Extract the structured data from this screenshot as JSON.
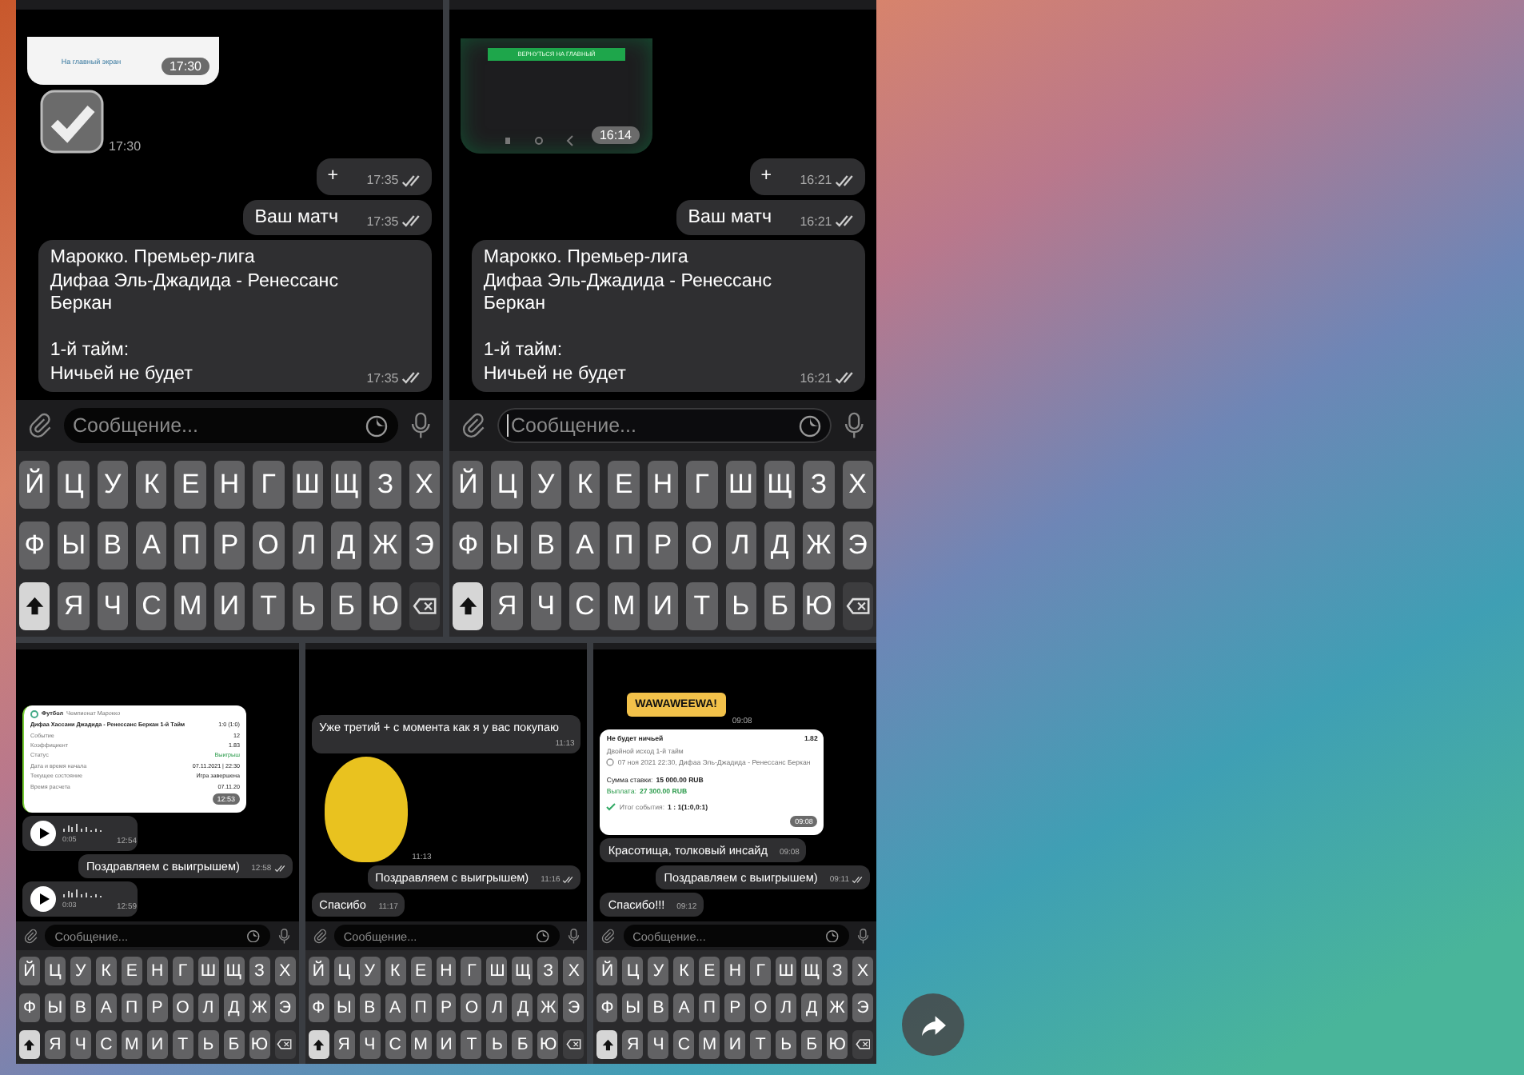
{
  "collage": {
    "top_row": [
      {
        "messages": [
          {
            "kind": "link_screenshot",
            "caption": "На главный экран",
            "time": "17:30"
          },
          {
            "kind": "check_sticker",
            "time": "17:30"
          },
          {
            "kind": "text",
            "outgoing": true,
            "text": "+",
            "time": "17:35",
            "read": true
          },
          {
            "kind": "text",
            "outgoing": true,
            "text": "Ваш  матч",
            "time": "17:35",
            "read": true
          },
          {
            "kind": "text",
            "outgoing": true,
            "text": "Марокко. Премьер-лига\nДифаа Эль-Джадида - Ренессанс\nБеркан\n\n1-й тайм:\nНичьей не будет",
            "time": "17:35",
            "read": true
          }
        ],
        "composer": {
          "placeholder": "Сообщение...",
          "focused": false
        },
        "keyboard": {
          "rows": [
            [
              {
                "kind": "letter",
                "label": "Й"
              },
              {
                "kind": "letter",
                "label": "Ц"
              },
              {
                "kind": "letter",
                "label": "У"
              },
              {
                "kind": "letter",
                "label": "К"
              },
              {
                "kind": "letter",
                "label": "Е"
              },
              {
                "kind": "letter",
                "label": "Н"
              },
              {
                "kind": "letter",
                "label": "Г"
              },
              {
                "kind": "letter",
                "label": "Ш"
              },
              {
                "kind": "letter",
                "label": "Щ"
              },
              {
                "kind": "letter",
                "label": "З"
              },
              {
                "kind": "letter",
                "label": "Х"
              }
            ],
            [
              {
                "kind": "letter",
                "label": "Ф"
              },
              {
                "kind": "letter",
                "label": "Ы"
              },
              {
                "kind": "letter",
                "label": "В"
              },
              {
                "kind": "letter",
                "label": "А"
              },
              {
                "kind": "letter",
                "label": "П"
              },
              {
                "kind": "letter",
                "label": "Р"
              },
              {
                "kind": "letter",
                "label": "О"
              },
              {
                "kind": "letter",
                "label": "Л"
              },
              {
                "kind": "letter",
                "label": "Д"
              },
              {
                "kind": "letter",
                "label": "Ж"
              },
              {
                "kind": "letter",
                "label": "Э"
              }
            ],
            [
              {
                "kind": "shift",
                "on": true
              },
              {
                "kind": "letter",
                "label": "Я"
              },
              {
                "kind": "letter",
                "label": "Ч"
              },
              {
                "kind": "letter",
                "label": "С"
              },
              {
                "kind": "letter",
                "label": "М"
              },
              {
                "kind": "letter",
                "label": "И"
              },
              {
                "kind": "letter",
                "label": "Т"
              },
              {
                "kind": "letter",
                "label": "Ь"
              },
              {
                "kind": "letter",
                "label": "Б"
              },
              {
                "kind": "letter",
                "label": "Ю"
              },
              {
                "kind": "backspace"
              }
            ]
          ]
        }
      },
      {
        "messages": [
          {
            "kind": "button_screenshot",
            "caption": "ВЕРНУТЬСЯ НА ГЛАВНЫЙ",
            "time": "16:14"
          },
          {
            "kind": "text",
            "outgoing": true,
            "text": "+",
            "time": "16:21",
            "read": true
          },
          {
            "kind": "text",
            "outgoing": true,
            "text": "Ваш матч",
            "time": "16:21",
            "read": true
          },
          {
            "kind": "text",
            "outgoing": true,
            "text": "Марокко. Премьер-лига\nДифаа Эль-Джадида - Ренессанс\nБеркан\n\n1-й тайм:\nНичьей не будет",
            "time": "16:21",
            "read": true
          }
        ],
        "composer": {
          "placeholder": "Сообщение...",
          "focused": true
        },
        "keyboard": {
          "rows": [
            [
              {
                "kind": "letter",
                "label": "Й"
              },
              {
                "kind": "letter",
                "label": "Ц"
              },
              {
                "kind": "letter",
                "label": "У"
              },
              {
                "kind": "letter",
                "label": "К"
              },
              {
                "kind": "letter",
                "label": "Е"
              },
              {
                "kind": "letter",
                "label": "Н"
              },
              {
                "kind": "letter",
                "label": "Г"
              },
              {
                "kind": "letter",
                "label": "Ш"
              },
              {
                "kind": "letter",
                "label": "Щ"
              },
              {
                "kind": "letter",
                "label": "З"
              },
              {
                "kind": "letter",
                "label": "Х"
              }
            ],
            [
              {
                "kind": "letter",
                "label": "Ф"
              },
              {
                "kind": "letter",
                "label": "Ы"
              },
              {
                "kind": "letter",
                "label": "В"
              },
              {
                "kind": "letter",
                "label": "А"
              },
              {
                "kind": "letter",
                "label": "П"
              },
              {
                "kind": "letter",
                "label": "Р"
              },
              {
                "kind": "letter",
                "label": "О"
              },
              {
                "kind": "letter",
                "label": "Л"
              },
              {
                "kind": "letter",
                "label": "Д"
              },
              {
                "kind": "letter",
                "label": "Ж"
              },
              {
                "kind": "letter",
                "label": "Э"
              }
            ],
            [
              {
                "kind": "shift",
                "on": true
              },
              {
                "kind": "letter",
                "label": "Я"
              },
              {
                "kind": "letter",
                "label": "Ч"
              },
              {
                "kind": "letter",
                "label": "С"
              },
              {
                "kind": "letter",
                "label": "М"
              },
              {
                "kind": "letter",
                "label": "И"
              },
              {
                "kind": "letter",
                "label": "Т"
              },
              {
                "kind": "letter",
                "label": "Ь"
              },
              {
                "kind": "letter",
                "label": "Б"
              },
              {
                "kind": "letter",
                "label": "Ю"
              },
              {
                "kind": "backspace"
              }
            ]
          ]
        }
      }
    ],
    "bottom_row": [
      {
        "messages": [
          {
            "kind": "result_card",
            "sport": "Футбол",
            "league": "Чемпионат Марокко",
            "match": "Дифаа Хассани Джадида - Ренессанс Беркан 1-й Тайм",
            "score": "1:0 (1:0)",
            "rows": [
              {
                "label": "Событие",
                "value": "12"
              },
              {
                "label": "Коэффициент",
                "value": "1.83"
              },
              {
                "label": "Статус",
                "value": "Выигрыш"
              },
              {
                "label": "Дата и время начала",
                "value": "07.11.2021 | 22:30"
              },
              {
                "label": "Текущее состояние",
                "value": "Игра завершена"
              },
              {
                "label": "Время расчета",
                "value": "07.11.20"
              }
            ],
            "time": "12:53"
          },
          {
            "kind": "voice",
            "duration": "0:05",
            "time": "12:54"
          },
          {
            "kind": "text",
            "outgoing": true,
            "text": "Поздравляем с выигрышем)",
            "time": "12:58",
            "read": true
          },
          {
            "kind": "voice",
            "duration": "0:03",
            "time": "12:59"
          }
        ],
        "composer": {
          "placeholder": "Сообщение...",
          "focused": false
        },
        "keyboard": {
          "rows": [
            [
              {
                "kind": "letter",
                "label": "Й"
              },
              {
                "kind": "letter",
                "label": "Ц"
              },
              {
                "kind": "letter",
                "label": "У"
              },
              {
                "kind": "letter",
                "label": "К"
              },
              {
                "kind": "letter",
                "label": "Е"
              },
              {
                "kind": "letter",
                "label": "Н"
              },
              {
                "kind": "letter",
                "label": "Г"
              },
              {
                "kind": "letter",
                "label": "Ш"
              },
              {
                "kind": "letter",
                "label": "Щ"
              },
              {
                "kind": "letter",
                "label": "З"
              },
              {
                "kind": "letter",
                "label": "Х"
              }
            ],
            [
              {
                "kind": "letter",
                "label": "Ф"
              },
              {
                "kind": "letter",
                "label": "Ы"
              },
              {
                "kind": "letter",
                "label": "В"
              },
              {
                "kind": "letter",
                "label": "А"
              },
              {
                "kind": "letter",
                "label": "П"
              },
              {
                "kind": "letter",
                "label": "Р"
              },
              {
                "kind": "letter",
                "label": "О"
              },
              {
                "kind": "letter",
                "label": "Л"
              },
              {
                "kind": "letter",
                "label": "Д"
              },
              {
                "kind": "letter",
                "label": "Ж"
              },
              {
                "kind": "letter",
                "label": "Э"
              }
            ],
            [
              {
                "kind": "shift",
                "on": true
              },
              {
                "kind": "letter",
                "label": "Я"
              },
              {
                "kind": "letter",
                "label": "Ч"
              },
              {
                "kind": "letter",
                "label": "С"
              },
              {
                "kind": "letter",
                "label": "М"
              },
              {
                "kind": "letter",
                "label": "И"
              },
              {
                "kind": "letter",
                "label": "Т"
              },
              {
                "kind": "letter",
                "label": "Ь"
              },
              {
                "kind": "letter",
                "label": "Б"
              },
              {
                "kind": "letter",
                "label": "Ю"
              },
              {
                "kind": "backspace"
              }
            ]
          ]
        }
      },
      {
        "messages": [
          {
            "kind": "text",
            "outgoing": false,
            "text": "Уже третий + с момента как я у вас покупаю",
            "time": "11:13"
          },
          {
            "kind": "photo_sticker",
            "time": "11:13"
          },
          {
            "kind": "text",
            "outgoing": true,
            "text": "Поздравляем с выигрышем)",
            "time": "11:16",
            "read": true
          },
          {
            "kind": "text",
            "outgoing": false,
            "text": "Спасибо",
            "time": "11:17"
          }
        ],
        "composer": {
          "placeholder": "Сообщение...",
          "focused": false
        },
        "keyboard": {
          "rows": [
            [
              {
                "kind": "letter",
                "label": "Й"
              },
              {
                "kind": "letter",
                "label": "Ц"
              },
              {
                "kind": "letter",
                "label": "У"
              },
              {
                "kind": "letter",
                "label": "К"
              },
              {
                "kind": "letter",
                "label": "Е"
              },
              {
                "kind": "letter",
                "label": "Н"
              },
              {
                "kind": "letter",
                "label": "Г"
              },
              {
                "kind": "letter",
                "label": "Ш"
              },
              {
                "kind": "letter",
                "label": "Щ"
              },
              {
                "kind": "letter",
                "label": "З"
              },
              {
                "kind": "letter",
                "label": "Х"
              }
            ],
            [
              {
                "kind": "letter",
                "label": "Ф"
              },
              {
                "kind": "letter",
                "label": "Ы"
              },
              {
                "kind": "letter",
                "label": "В"
              },
              {
                "kind": "letter",
                "label": "А"
              },
              {
                "kind": "letter",
                "label": "П"
              },
              {
                "kind": "letter",
                "label": "Р"
              },
              {
                "kind": "letter",
                "label": "О"
              },
              {
                "kind": "letter",
                "label": "Л"
              },
              {
                "kind": "letter",
                "label": "Д"
              },
              {
                "kind": "letter",
                "label": "Ж"
              },
              {
                "kind": "letter",
                "label": "Э"
              }
            ],
            [
              {
                "kind": "shift",
                "on": true
              },
              {
                "kind": "letter",
                "label": "Я"
              },
              {
                "kind": "letter",
                "label": "Ч"
              },
              {
                "kind": "letter",
                "label": "С"
              },
              {
                "kind": "letter",
                "label": "М"
              },
              {
                "kind": "letter",
                "label": "И"
              },
              {
                "kind": "letter",
                "label": "Т"
              },
              {
                "kind": "letter",
                "label": "Ь"
              },
              {
                "kind": "letter",
                "label": "Б"
              },
              {
                "kind": "letter",
                "label": "Ю"
              },
              {
                "kind": "backspace"
              }
            ]
          ]
        }
      },
      {
        "messages": [
          {
            "kind": "text_sticker",
            "text": "WAWAWEEWA!",
            "time": "09:08"
          },
          {
            "kind": "bet_card",
            "title": "Не будет ничьей",
            "odds": "1.82",
            "market": "Двойной исход 1-й тайм",
            "event": "07 ноя 2021 22:30, Дифаа Эль-Джадида - Ренессанс Беркан",
            "stake_label": "Сумма ставки:",
            "stake": "15 000.00 RUB",
            "payout_label": "Выплата:",
            "payout": "27 300.00 RUB",
            "result_label": "Итог события:",
            "result": "1 : 1(1:0,0:1)",
            "time": "09:08"
          },
          {
            "kind": "text",
            "outgoing": false,
            "text": "Красотища, толковый инсайд",
            "time": "09:08"
          },
          {
            "kind": "text",
            "outgoing": true,
            "text": "Поздравляем с выигрышем)",
            "time": "09:11",
            "read": true
          },
          {
            "kind": "text",
            "outgoing": false,
            "text": "Спасибо!!!",
            "time": "09:12"
          }
        ],
        "composer": {
          "placeholder": "Сообщение...",
          "focused": false
        },
        "keyboard": {
          "rows": [
            [
              {
                "kind": "letter",
                "label": "Й"
              },
              {
                "kind": "letter",
                "label": "Ц"
              },
              {
                "kind": "letter",
                "label": "У"
              },
              {
                "kind": "letter",
                "label": "К"
              },
              {
                "kind": "letter",
                "label": "Е"
              },
              {
                "kind": "letter",
                "label": "Н"
              },
              {
                "kind": "letter",
                "label": "Г"
              },
              {
                "kind": "letter",
                "label": "Ш"
              },
              {
                "kind": "letter",
                "label": "Щ"
              },
              {
                "kind": "letter",
                "label": "З"
              },
              {
                "kind": "letter",
                "label": "Х"
              }
            ],
            [
              {
                "kind": "letter",
                "label": "Ф"
              },
              {
                "kind": "letter",
                "label": "Ы"
              },
              {
                "kind": "letter",
                "label": "В"
              },
              {
                "kind": "letter",
                "label": "А"
              },
              {
                "kind": "letter",
                "label": "П"
              },
              {
                "kind": "letter",
                "label": "Р"
              },
              {
                "kind": "letter",
                "label": "О"
              },
              {
                "kind": "letter",
                "label": "Л"
              },
              {
                "kind": "letter",
                "label": "Д"
              },
              {
                "kind": "letter",
                "label": "Ж"
              },
              {
                "kind": "letter",
                "label": "Э"
              }
            ],
            [
              {
                "kind": "shift",
                "on": true
              },
              {
                "kind": "letter",
                "label": "Я"
              },
              {
                "kind": "letter",
                "label": "Ч"
              },
              {
                "kind": "letter",
                "label": "С"
              },
              {
                "kind": "letter",
                "label": "М"
              },
              {
                "kind": "letter",
                "label": "И"
              },
              {
                "kind": "letter",
                "label": "Т"
              },
              {
                "kind": "letter",
                "label": "Ь"
              },
              {
                "kind": "letter",
                "label": "Б"
              },
              {
                "kind": "letter",
                "label": "Ю"
              },
              {
                "kind": "backspace"
              }
            ]
          ]
        }
      }
    ]
  }
}
